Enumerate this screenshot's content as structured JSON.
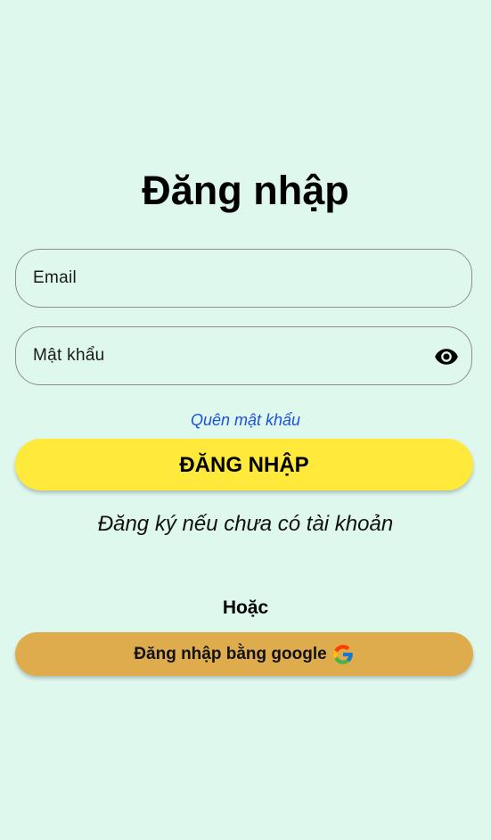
{
  "page": {
    "title": "Đăng nhập"
  },
  "form": {
    "email_placeholder": "Email",
    "password_placeholder": "Mật khẩu",
    "forgot_password": "Quên mật khẩu",
    "login_button": "ĐĂNG NHẬP",
    "register_link": "Đăng ký nếu chưa có tài khoản",
    "or_divider": "Hoặc",
    "google_button": "Đăng nhập bằng google"
  },
  "icons": {
    "password_toggle": "eye-icon",
    "google": "google-logo-icon"
  },
  "colors": {
    "background": "#def8ee",
    "primary_button": "#ffe93a",
    "google_button": "#dfac4d",
    "link": "#1b4fe0"
  }
}
